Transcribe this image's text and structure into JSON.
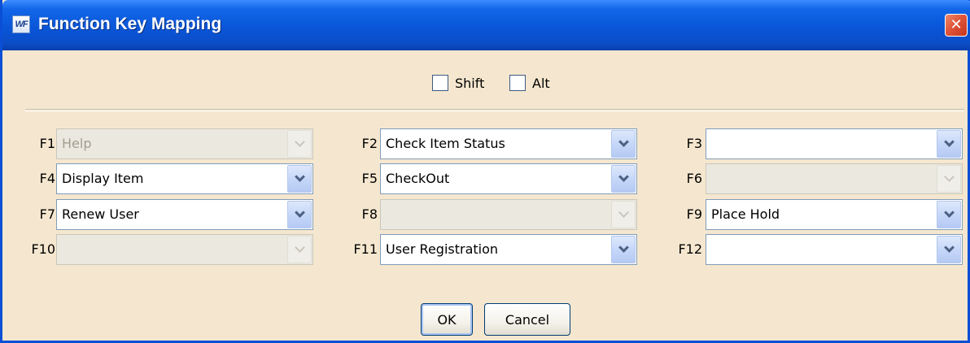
{
  "window": {
    "title": "Function Key Mapping",
    "app_icon_text": "WF",
    "close_glyph": "✕"
  },
  "modifiers": {
    "shift": {
      "label": "Shift",
      "checked": false
    },
    "alt": {
      "label": "Alt",
      "checked": false
    }
  },
  "mappings": [
    {
      "key": "F1",
      "value": "Help",
      "enabled": false
    },
    {
      "key": "F2",
      "value": "Check Item Status",
      "enabled": true
    },
    {
      "key": "F3",
      "value": "",
      "enabled": true
    },
    {
      "key": "F4",
      "value": "Display Item",
      "enabled": true
    },
    {
      "key": "F5",
      "value": "CheckOut",
      "enabled": true
    },
    {
      "key": "F6",
      "value": "",
      "enabled": false
    },
    {
      "key": "F7",
      "value": "Renew User",
      "enabled": true
    },
    {
      "key": "F8",
      "value": "",
      "enabled": false
    },
    {
      "key": "F9",
      "value": "Place Hold",
      "enabled": true
    },
    {
      "key": "F10",
      "value": "",
      "enabled": false
    },
    {
      "key": "F11",
      "value": "User Registration",
      "enabled": true
    },
    {
      "key": "F12",
      "value": "",
      "enabled": true
    }
  ],
  "buttons": {
    "ok": "OK",
    "cancel": "Cancel"
  },
  "colors": {
    "titlebar": "#0a56d8",
    "dialog_background": "#f5e7cf",
    "close_button": "#e0553a"
  }
}
